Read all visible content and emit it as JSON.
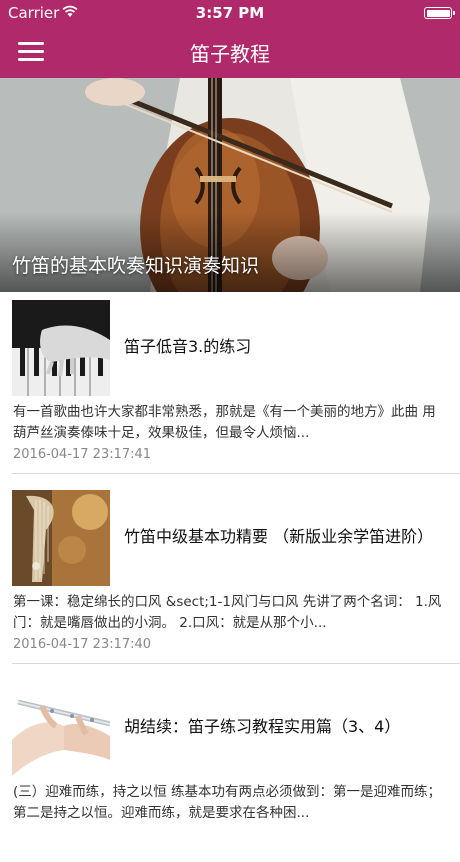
{
  "status_bar": {
    "carrier": "Carrier",
    "time": "3:57 PM"
  },
  "nav": {
    "title": "笛子教程"
  },
  "hero": {
    "caption": "竹笛的基本吹奏知识演奏知识"
  },
  "articles": [
    {
      "title": "笛子低音3.的练习",
      "summary": "有一首歌曲也许大家都非常熟悉，那就是《有一个美丽的地方》此曲 用葫芦丝演奏傣味十足，效果极佳，但最令人烦恼...",
      "date": "2016-04-17 23:17:41"
    },
    {
      "title": "竹笛中级基本功精要 （新版业余学笛进阶）",
      "summary": "第一课：稳定绵长的口风 &sect;1-1风门与口风 先讲了两个名词： 1.风门：就是嘴唇做出的小洞。 2.口风：就是从那个小...",
      "date": "2016-04-17 23:17:40"
    },
    {
      "title": "胡结续：笛子练习教程实用篇（3、4）",
      "summary": "(三）迎难而练，持之以恒 练基本功有两点必须做到：第一是迎难而练；第二是持之以恒。迎难而练，就是要求在各种困..."
    }
  ]
}
